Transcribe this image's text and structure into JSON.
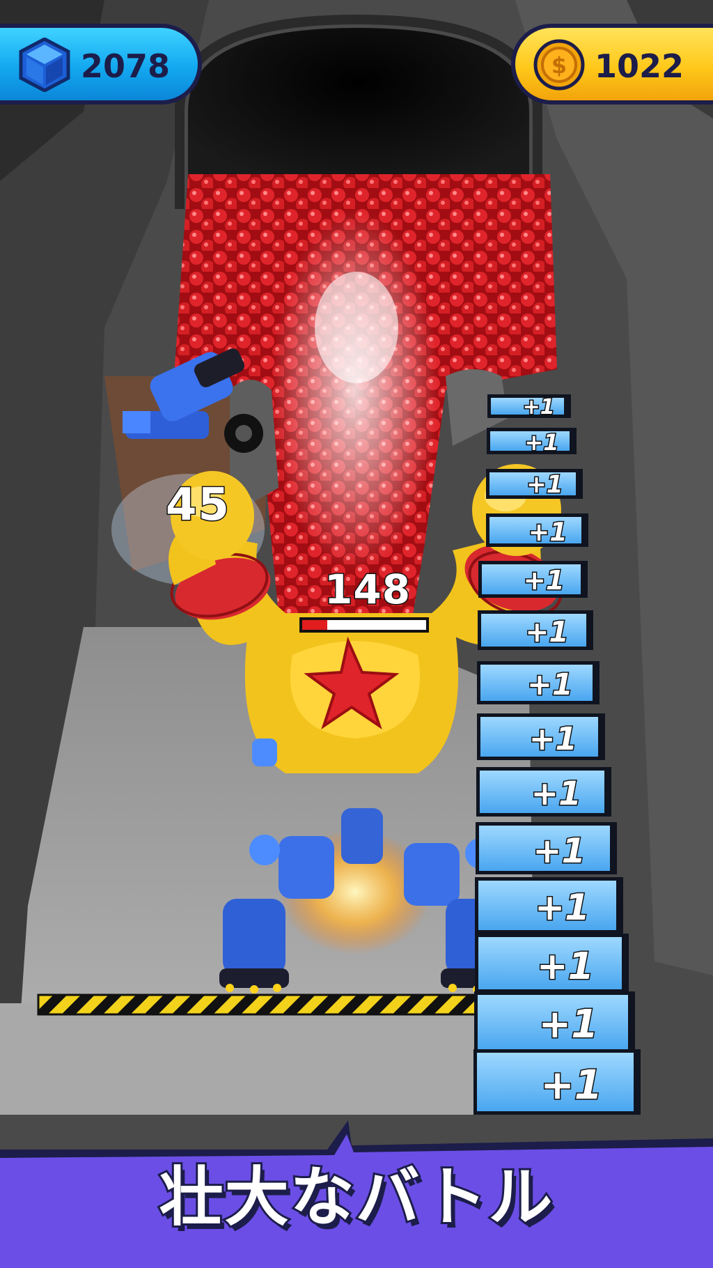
{
  "hud": {
    "gems": {
      "icon": "gem-cube-icon",
      "value": "2078",
      "color": "#13a8f0"
    },
    "coins": {
      "icon": "coin-icon",
      "value": "1022",
      "color": "#ffc81a"
    }
  },
  "combat": {
    "damage_number": "45",
    "boss_hp_value": "148",
    "boss_hp_fraction": 0.2
  },
  "stairs": {
    "labels": [
      "+1",
      "+1",
      "+1",
      "+1",
      "+1",
      "+1",
      "+1",
      "+1",
      "+1",
      "+1",
      "+1",
      "+1",
      "+1",
      "+1"
    ]
  },
  "banner": {
    "title": "壮大なバトル",
    "color": "#6b4ee6"
  }
}
